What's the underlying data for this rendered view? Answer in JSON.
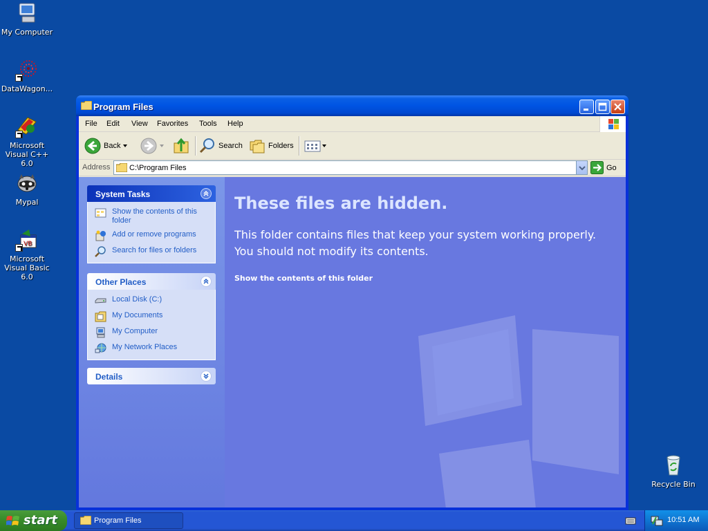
{
  "desktop": {
    "icons": [
      {
        "label": "My Computer"
      },
      {
        "label": "DataWagon..."
      },
      {
        "label": "Microsoft Visual C++ 6.0"
      },
      {
        "label": "Mypal"
      },
      {
        "label": "Microsoft Visual Basic 6.0"
      },
      {
        "label": "Recycle Bin"
      }
    ]
  },
  "window": {
    "title": "Program Files",
    "menu": [
      "File",
      "Edit",
      "View",
      "Favorites",
      "Tools",
      "Help"
    ],
    "toolbar": {
      "back": "Back",
      "search": "Search",
      "folders": "Folders"
    },
    "address": {
      "label": "Address",
      "value": "C:\\Program Files",
      "go": "Go"
    },
    "taskpane": {
      "system_tasks": {
        "title": "System Tasks",
        "items": [
          "Show the contents of this folder",
          "Add or remove programs",
          "Search for files or folders"
        ]
      },
      "other_places": {
        "title": "Other Places",
        "items": [
          "Local Disk (C:)",
          "My Documents",
          "My Computer",
          "My Network Places"
        ]
      },
      "details": {
        "title": "Details"
      }
    },
    "main": {
      "heading": "These files are hidden.",
      "message": "This folder contains files that keep your system working properly. You should not modify its contents.",
      "link": "Show the contents of this folder"
    }
  },
  "taskbar": {
    "start": "start",
    "items": [
      "Program Files"
    ],
    "clock": "10:51 AM"
  },
  "colors": {
    "desktop": "#0a4aa3",
    "titlebar": "#0054e3",
    "taskpane_link": "#215dc6",
    "start_green": "#3a8d2b"
  }
}
